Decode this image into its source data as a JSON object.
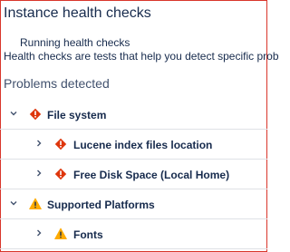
{
  "page": {
    "title": "Instance health checks",
    "running_text": "Running health checks",
    "description": "Health checks are tests that help you detect specific prob",
    "problems_heading": "Problems detected"
  },
  "tree": {
    "file_system": {
      "label": "File system",
      "expand_icon": "chevron-down-icon",
      "status_icon": "error-icon"
    },
    "lucene": {
      "label": "Lucene index files location",
      "expand_icon": "chevron-right-icon",
      "status_icon": "error-icon"
    },
    "disk_space": {
      "label": "Free Disk Space (Local Home)",
      "expand_icon": "chevron-right-icon",
      "status_icon": "error-icon"
    },
    "supported_platforms": {
      "label": "Supported Platforms",
      "expand_icon": "chevron-down-icon",
      "status_icon": "warning-icon"
    },
    "fonts": {
      "label": "Fonts",
      "expand_icon": "chevron-right-icon",
      "status_icon": "warning-icon"
    }
  },
  "colors": {
    "error": "#de350b",
    "warning": "#ffab00",
    "text": "#172b4d",
    "frame_border": "#d9362b"
  }
}
